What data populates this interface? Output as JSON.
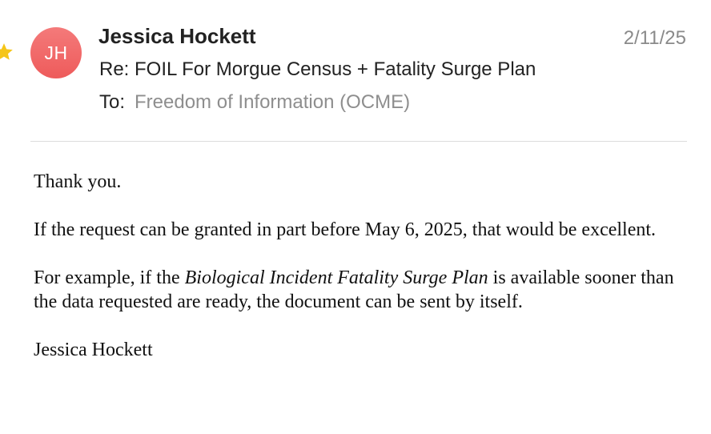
{
  "message": {
    "sender_initials": "JH",
    "sender_name": "Jessica Hockett",
    "date": "2/11/25",
    "subject": "Re: FOIL For Morgue Census + Fatality Surge Plan",
    "to_label": "To:",
    "to_value": "Freedom of Information (OCME)",
    "starred": true
  },
  "body": {
    "greeting": "Thank you.",
    "paragraph_1": "If the request can be granted in part before May 6, 2025, that would be excellent.",
    "paragraph_2_prefix": "For example, if the ",
    "paragraph_2_title": "Biological Incident Fatality Surge Plan",
    "paragraph_2_suffix": " is available sooner than the data requested are ready, the document can be sent by itself.",
    "signature": "Jessica Hockett"
  },
  "colors": {
    "avatar": "#ef6464",
    "star": "#f5c518",
    "muted_text": "#8e8e8e"
  },
  "icons": {
    "star": "star-icon"
  }
}
